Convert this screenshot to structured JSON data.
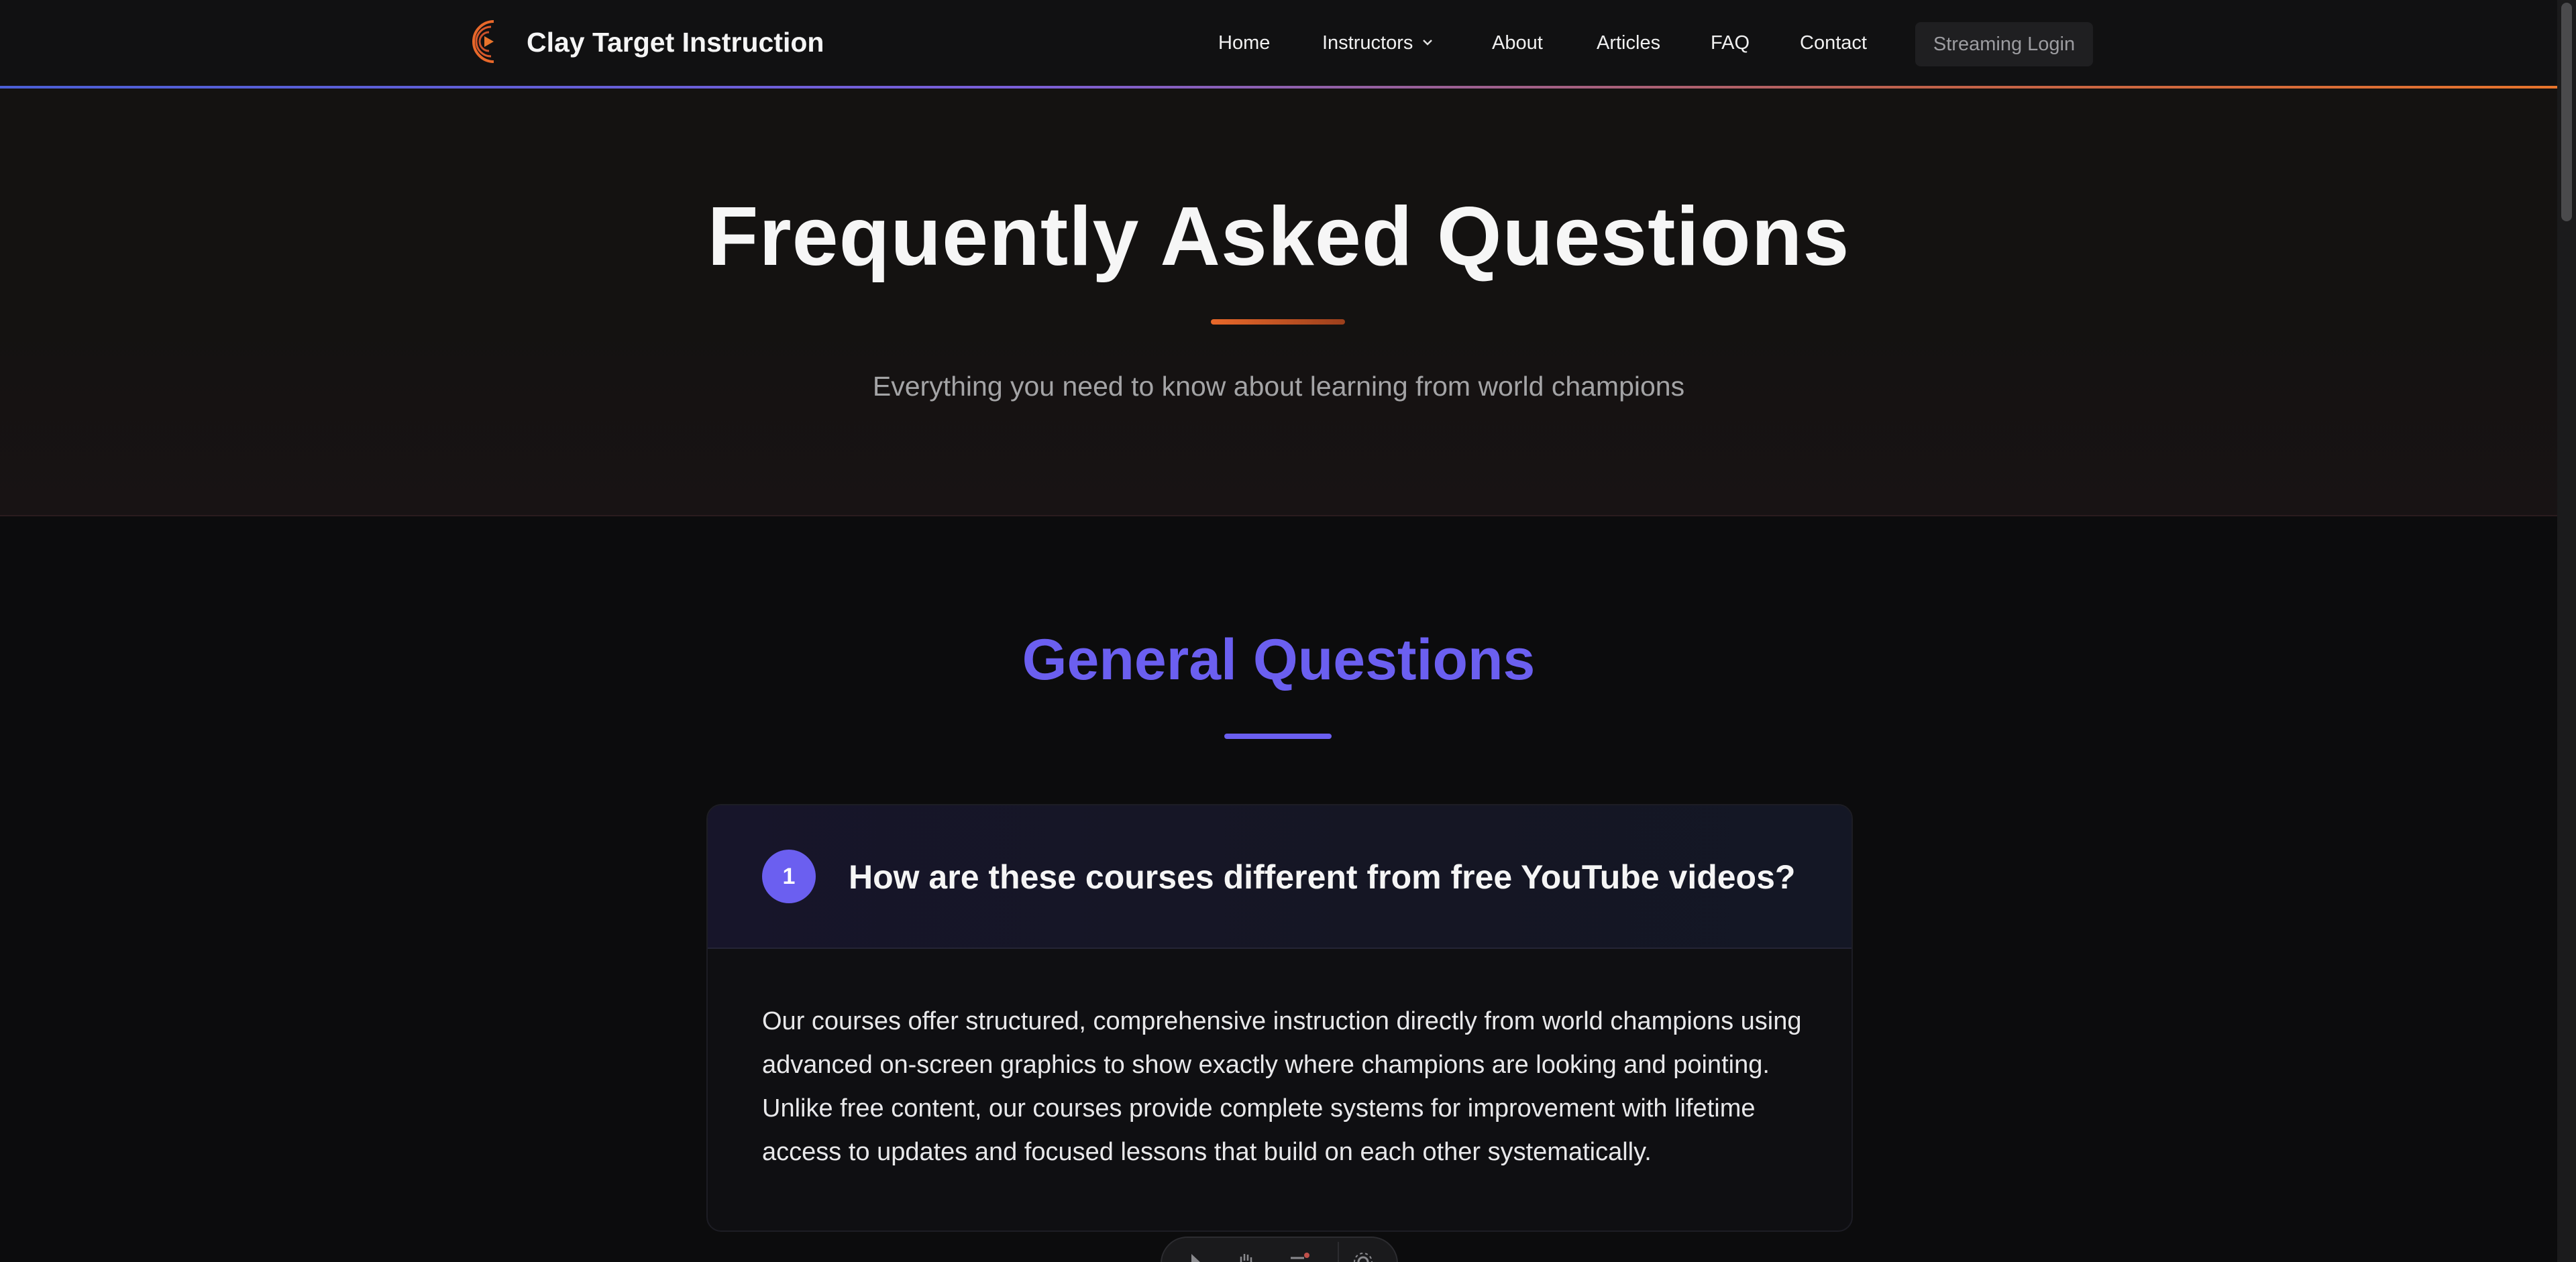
{
  "header": {
    "brand": "Clay Target Instruction",
    "nav": [
      {
        "label": "Home"
      },
      {
        "label": "Instructors"
      },
      {
        "label": "About"
      },
      {
        "label": "Articles"
      },
      {
        "label": "FAQ"
      },
      {
        "label": "Contact"
      }
    ],
    "login_label": "Streaming Login"
  },
  "hero": {
    "title": "Frequently Asked Questions",
    "subtitle": "Everything you need to know about learning from world champions"
  },
  "section": {
    "title": "General Questions"
  },
  "faq": {
    "number": "1",
    "question": "How are these courses different from free YouTube videos?",
    "answer": "Our courses offer structured, comprehensive instruction directly from world champions using advanced on-screen graphics to show exactly where champions are looking and pointing. Unlike free content, our courses provide complete systems for improvement with lifetime access to updates and focused lessons that build on each other systematically."
  },
  "colors": {
    "accent": "#6b5ff0",
    "orange": "#e8682a",
    "background": "#0c0c0d"
  },
  "icons": [
    "logo-icon",
    "chevron-down-icon",
    "toolbar-icons"
  ]
}
